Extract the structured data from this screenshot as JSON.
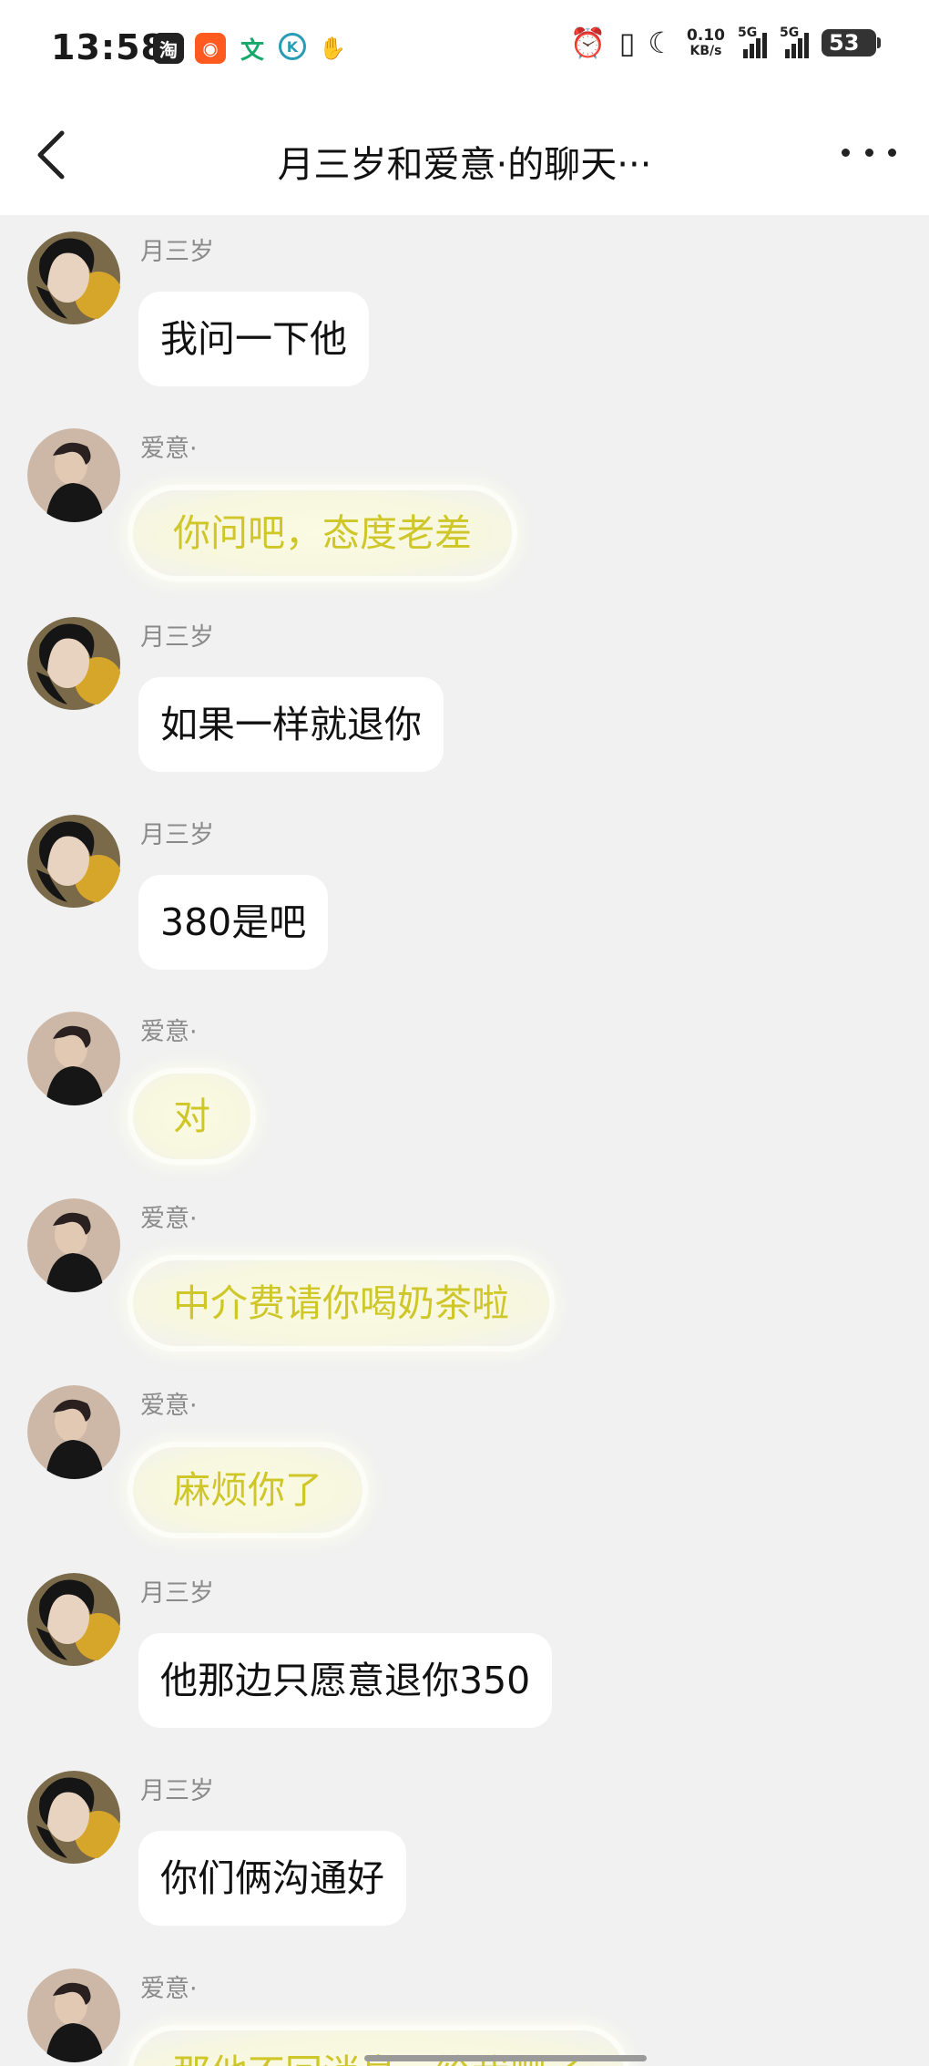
{
  "status_bar": {
    "time": "13:58",
    "app_icons": [
      "taobao-icon",
      "kuaishou-icon",
      "wen-icon",
      "k-icon",
      "handshake-icon"
    ],
    "net_speed_value": "0.10",
    "net_speed_unit": "KB/s",
    "signal1_label": "5G",
    "signal2_label": "5G",
    "battery": "53"
  },
  "nav": {
    "title": "月三岁和爱意·的聊天···"
  },
  "messages": [
    {
      "sender": "月三岁",
      "text": "我问一下他",
      "style": "plain"
    },
    {
      "sender": "爱意·",
      "text": "你问吧，态度老差",
      "style": "cloud"
    },
    {
      "sender": "月三岁",
      "text": "如果一样就退你",
      "style": "plain"
    },
    {
      "sender": "月三岁",
      "text": "380是吧",
      "style": "plain"
    },
    {
      "sender": "爱意·",
      "text": "对",
      "style": "cloud"
    },
    {
      "sender": "爱意·",
      "text": "中介费请你喝奶茶啦",
      "style": "cloud"
    },
    {
      "sender": "爱意·",
      "text": "麻烦你了",
      "style": "cloud"
    },
    {
      "sender": "月三岁",
      "text": "他那边只愿意退你350",
      "style": "plain"
    },
    {
      "sender": "月三岁",
      "text": "你们俩沟通好",
      "style": "plain"
    },
    {
      "sender": "爱意·",
      "text": "那他不回消息，给我删了",
      "style": "cloud"
    }
  ],
  "colors": {
    "background": "#f1f1f1",
    "bubble": "#ffffff",
    "cloud_text": "#cfc72a",
    "sender": "#8a8a8a"
  }
}
